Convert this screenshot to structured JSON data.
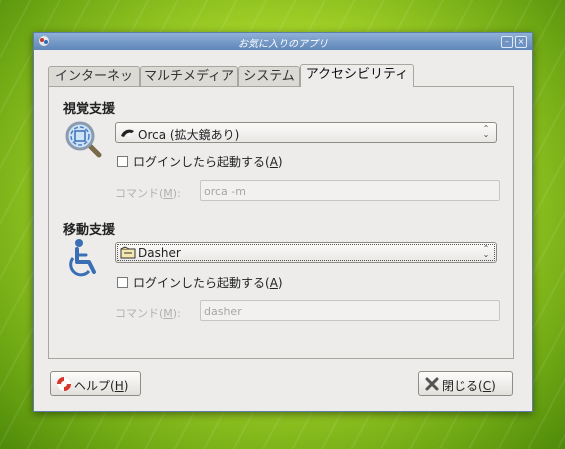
{
  "window": {
    "title": "お気に入りのアプリ",
    "minimize_glyph": "–",
    "close_glyph": "×"
  },
  "tabs": [
    {
      "label": "インターネット",
      "active": false
    },
    {
      "label": "マルチメディア",
      "active": false
    },
    {
      "label": "システム",
      "active": false
    },
    {
      "label": "アクセシビリティ",
      "active": true
    }
  ],
  "visual": {
    "heading": "視覚支援",
    "icon": "magnifier-icon",
    "combo_value": "Orca (拡大鏡あり)",
    "combo_icon": "orca-whale-icon",
    "checkbox_label_prefix": "ログインしたら起動する(",
    "checkbox_mnemonic": "A",
    "checkbox_label_suffix": ")",
    "checkbox_checked": false,
    "command_label_prefix": "コマンド(",
    "command_mnemonic": "M",
    "command_label_suffix": "):",
    "command_value": "orca -m"
  },
  "mobility": {
    "heading": "移動支援",
    "icon": "wheelchair-icon",
    "combo_value": "Dasher",
    "combo_icon": "dasher-icon",
    "checkbox_label_prefix": "ログインしたら起動する(",
    "checkbox_mnemonic": "A",
    "checkbox_label_suffix": ")",
    "checkbox_checked": false,
    "command_label_prefix": "コマンド(",
    "command_mnemonic": "M",
    "command_label_suffix": "):",
    "command_value": "dasher"
  },
  "buttons": {
    "help_prefix": "ヘルプ(",
    "help_mnemonic": "H",
    "help_suffix": ")",
    "close_prefix": "閉じる(",
    "close_mnemonic": "C",
    "close_suffix": ")"
  },
  "colors": {
    "titlebar": "#6f93c2",
    "window_bg": "#edeceb",
    "icon_blue": "#3a6fb5"
  }
}
